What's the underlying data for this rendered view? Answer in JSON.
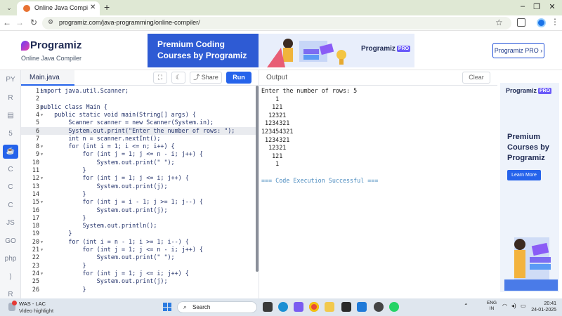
{
  "browser": {
    "tab_title": "Online Java Compiler - Programiz",
    "url": "programiz.com/java-programming/online-compiler/",
    "window_controls": [
      "–",
      "❐",
      "✕"
    ]
  },
  "header": {
    "logo_text": "Programiz",
    "logo_sub": "Online Java Compiler",
    "banner_line1": "Premium Coding",
    "banner_line2": "Courses by Programiz",
    "banner_logo": "Programiz",
    "banner_pro": "PRO",
    "pro_button": "Programiz PRO ›"
  },
  "rail": {
    "items": [
      {
        "label": "PY",
        "icon": "python-icon"
      },
      {
        "label": "R",
        "icon": "r-icon"
      },
      {
        "label": "▤",
        "icon": "sql-icon"
      },
      {
        "label": "5",
        "icon": "html-icon"
      },
      {
        "label": "☕",
        "icon": "java-icon"
      },
      {
        "label": "C",
        "icon": "c-icon"
      },
      {
        "label": "C",
        "icon": "cpp-icon"
      },
      {
        "label": "C",
        "icon": "csharp-icon"
      },
      {
        "label": "JS",
        "icon": "javascript-icon"
      },
      {
        "label": "GO",
        "icon": "go-icon"
      },
      {
        "label": "php",
        "icon": "php-icon"
      },
      {
        "label": "⟩",
        "icon": "swift-icon"
      },
      {
        "label": "R",
        "icon": "rust-icon"
      }
    ]
  },
  "editor": {
    "file_name": "Main.java",
    "share_label": "Share",
    "run_label": "Run",
    "highlighted_line": 6,
    "lines": [
      {
        "n": "1",
        "fold": true,
        "code": "import java.util.Scanner;"
      },
      {
        "n": "2",
        "fold": false,
        "code": ""
      },
      {
        "n": "3",
        "fold": true,
        "code": "public class Main {"
      },
      {
        "n": "4",
        "fold": true,
        "code": "    public static void main(String[] args) {"
      },
      {
        "n": "5",
        "fold": false,
        "code": "        Scanner scanner = new Scanner(System.in);"
      },
      {
        "n": "6",
        "fold": false,
        "code": "        System.out.print(\"Enter the number of rows: \");"
      },
      {
        "n": "7",
        "fold": false,
        "code": "        int n = scanner.nextInt();"
      },
      {
        "n": "8",
        "fold": true,
        "code": "        for (int i = 1; i <= n; i++) {"
      },
      {
        "n": "9",
        "fold": true,
        "code": "            for (int j = 1; j <= n - i; j++) {"
      },
      {
        "n": "10",
        "fold": false,
        "code": "                System.out.print(\" \");"
      },
      {
        "n": "11",
        "fold": false,
        "code": "            }"
      },
      {
        "n": "12",
        "fold": true,
        "code": "            for (int j = 1; j <= i; j++) {"
      },
      {
        "n": "13",
        "fold": false,
        "code": "                System.out.print(j);"
      },
      {
        "n": "14",
        "fold": false,
        "code": "            }"
      },
      {
        "n": "15",
        "fold": true,
        "code": "            for (int j = i - 1; j >= 1; j--) {"
      },
      {
        "n": "16",
        "fold": false,
        "code": "                System.out.print(j);"
      },
      {
        "n": "17",
        "fold": false,
        "code": "            }"
      },
      {
        "n": "18",
        "fold": false,
        "code": "            System.out.println();"
      },
      {
        "n": "19",
        "fold": false,
        "code": "        }"
      },
      {
        "n": "20",
        "fold": true,
        "code": "        for (int i = n - 1; i >= 1; i--) {"
      },
      {
        "n": "21",
        "fold": true,
        "code": "            for (int j = 1; j <= n - i; j++) {"
      },
      {
        "n": "22",
        "fold": false,
        "code": "                System.out.print(\" \");"
      },
      {
        "n": "23",
        "fold": false,
        "code": "            }"
      },
      {
        "n": "24",
        "fold": true,
        "code": "            for (int j = 1; j <= i; j++) {"
      },
      {
        "n": "25",
        "fold": false,
        "code": "                System.out.print(j);"
      },
      {
        "n": "26",
        "fold": false,
        "code": "            }"
      }
    ]
  },
  "output": {
    "label": "Output",
    "clear_label": "Clear",
    "lines": [
      "Enter the number of rows: 5",
      "    1",
      "   121",
      "  12321",
      " 1234321",
      "123454321",
      " 1234321",
      "  12321",
      "   121",
      "    1",
      "",
      "=== Code Execution Successful ==="
    ]
  },
  "ad": {
    "logo": "Programiz",
    "pro": "PRO",
    "text": "Premium Courses by Programiz",
    "button": "Learn More"
  },
  "taskbar": {
    "weather_title": "WAS - LAC",
    "weather_sub": "Video highlight",
    "search_label": "Search",
    "lang_line1": "ENG",
    "lang_line2": "IN",
    "time": "20:41",
    "date": "24-01-2025"
  },
  "colors": {
    "accent": "#2563eb",
    "brand_dark": "#1f2a53",
    "success": "#4b8bbf"
  }
}
